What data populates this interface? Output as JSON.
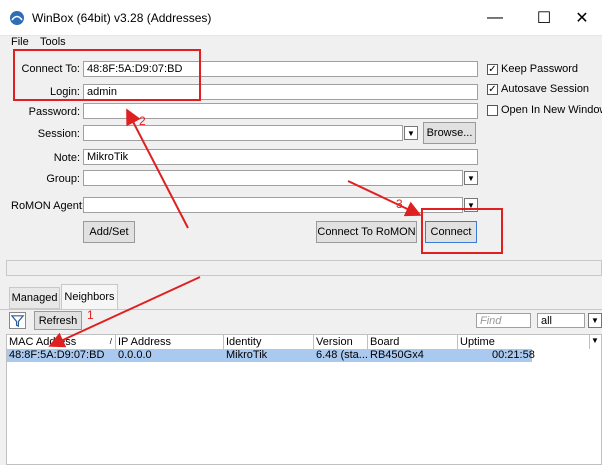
{
  "window": {
    "title": "WinBox (64bit) v3.28 (Addresses)"
  },
  "menu": [
    "File",
    "Tools"
  ],
  "form": {
    "connect_to_label": "Connect To:",
    "connect_to_value": "48:8F:5A:D9:07:BD",
    "login_label": "Login:",
    "login_value": "admin",
    "password_label": "Password:",
    "password_value": "",
    "session_label": "Session:",
    "session_value": "",
    "browse_label": "Browse...",
    "note_label": "Note:",
    "note_value": "MikroTik",
    "group_label": "Group:",
    "group_value": "",
    "romon_label": "RoMON Agent:",
    "romon_value": "",
    "keep_password_label": "Keep Password",
    "keep_password_checked": true,
    "autosave_label": "Autosave Session",
    "autosave_checked": true,
    "open_new_window_label": "Open In New Window",
    "open_new_window_checked": false,
    "add_set_label": "Add/Set",
    "connect_romon_label": "Connect To RoMON",
    "connect_label": "Connect"
  },
  "annotations": {
    "one": "1",
    "two": "2",
    "three": "3",
    "color": "#e02020"
  },
  "tabs": [
    "Managed",
    "Neighbors"
  ],
  "toolbar": {
    "refresh_label": "Refresh",
    "find_placeholder": "Find",
    "filter_value": "all"
  },
  "table": {
    "columns": [
      "MAC Address",
      "IP Address",
      "Identity",
      "Version",
      "Board",
      "Uptime"
    ],
    "rows": [
      [
        "48:8F:5A:D9:07:BD",
        "0.0.0.0",
        "MikroTik",
        "6.48 (sta...",
        "RB450Gx4",
        "00:21:58"
      ]
    ]
  },
  "colors": {
    "selected_row": "#a9c9ef",
    "highlight": "#e02020"
  }
}
